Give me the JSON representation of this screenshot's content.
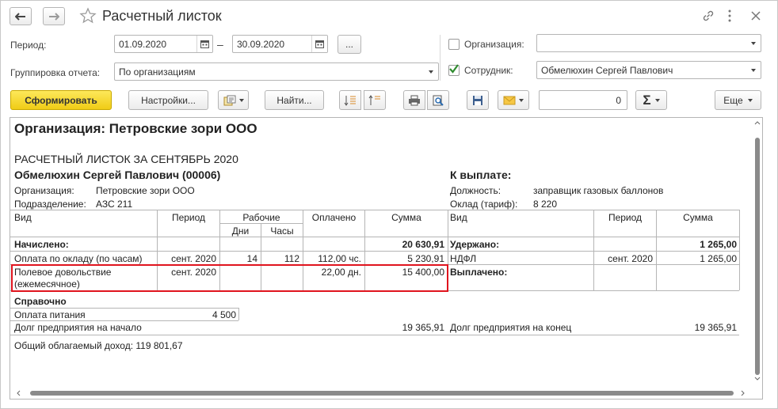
{
  "window": {
    "title": "Расчетный листок"
  },
  "form": {
    "period_label": "Период:",
    "period_from": "01.09.2020",
    "period_dash": "–",
    "period_to": "30.09.2020",
    "period_more": "...",
    "grouping_label": "Группировка отчета:",
    "grouping_value": "По организациям",
    "org_label": "Организация:",
    "org_checked": false,
    "org_value": "",
    "employee_label": "Сотрудник:",
    "employee_checked": true,
    "employee_value": "Обмелюхин Сергей Павлович"
  },
  "toolbar": {
    "generate_label": "Сформировать",
    "settings_label": "Настройки...",
    "find_label": "Найти...",
    "sum_value": "0",
    "sigma": "Σ",
    "more_label": "Еще"
  },
  "report": {
    "org_title": "Организация: Петровские зори ООО",
    "sheet_title": "РАСЧЕТНЫЙ ЛИСТОК ЗА СЕНТЯБРЬ 2020",
    "employee_name": "Обмелюхин Сергей Павлович (00006)",
    "org_label": "Организация:",
    "org_value": "Петровские зори ООО",
    "dept_label": "Подразделение:",
    "dept_value": "АЗС 211",
    "to_pay_label": "К выплате:",
    "position_label": "Должность:",
    "position_value": "заправщик газовых баллонов",
    "salary_label": "Оклад (тариф):",
    "salary_value": "8 220",
    "left_headers": {
      "kind": "Вид",
      "period": "Период",
      "working": "Рабочие",
      "days": "Дни",
      "hours": "Часы",
      "paid": "Оплачено",
      "sum": "Сумма"
    },
    "right_headers": {
      "kind": "Вид",
      "period": "Период",
      "sum": "Сумма"
    },
    "accrued_label": "Начислено:",
    "accrued_total": "20 630,91",
    "accrual_rows": [
      {
        "kind": "Оплата по окладу (по часам)",
        "period": "сент. 2020",
        "days": "14",
        "hours": "112",
        "paid": "112,00 чс.",
        "sum": "5 230,91"
      },
      {
        "kind_line1": "Полевое довольствие",
        "kind_line2": "(ежемесячное)",
        "period": "сент. 2020",
        "days": "",
        "hours": "",
        "paid": "22,00 дн.",
        "sum": "15 400,00"
      }
    ],
    "withheld_label": "Удержано:",
    "withheld_total": "1 265,00",
    "withheld_rows": [
      {
        "kind": "НДФЛ",
        "period": "сент. 2020",
        "sum": "1 265,00"
      }
    ],
    "paid_out_label": "Выплачено:",
    "reference_label": "Справочно",
    "meal_label": "Оплата питания",
    "meal_value": "4 500",
    "debt_start_label": "Долг предприятия на начало",
    "debt_start_value": "19 365,91",
    "debt_end_label": "Долг предприятия на конец",
    "debt_end_value": "19 365,91",
    "taxable_income": "Общий облагаемый доход: 119 801,67"
  },
  "colors": {
    "primary_button": "#f5d327",
    "highlight_border": "#e0141e",
    "check_mark": "#2e8b2e"
  }
}
